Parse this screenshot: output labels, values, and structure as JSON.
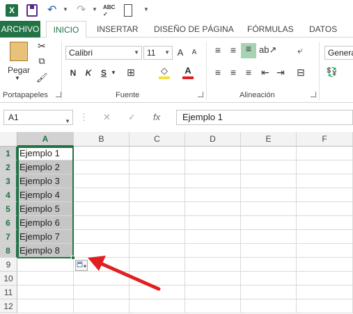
{
  "qat": {
    "excel_letter": "X",
    "spell_label": "ABC"
  },
  "tabs": [
    "ARCHIVO",
    "INICIO",
    "INSERTAR",
    "DISEÑO DE PÁGINA",
    "FÓRMULAS",
    "DATOS"
  ],
  "ribbon": {
    "paste_label": "Pegar",
    "font_name": "Calibri",
    "font_size": "11",
    "bold": "N",
    "italic": "K",
    "underline": "S",
    "number_format": "Genera",
    "groups": {
      "clipboard": "Portapapeles",
      "font": "Fuente",
      "alignment": "Alineación"
    }
  },
  "formula_bar": {
    "name_box": "A1",
    "fx": "fx",
    "value": "Ejemplo 1"
  },
  "sheet": {
    "columns": [
      "A",
      "B",
      "C",
      "D",
      "E",
      "F"
    ],
    "rows": [
      "1",
      "2",
      "3",
      "4",
      "5",
      "6",
      "7",
      "8",
      "9",
      "10",
      "11",
      "12"
    ],
    "column_a": [
      "Ejemplo 1",
      "Ejemplo 2",
      "Ejemplo 3",
      "Ejemplo 4",
      "Ejemplo 5",
      "Ejemplo 6",
      "Ejemplo 7",
      "Ejemplo 8"
    ]
  },
  "colors": {
    "accent": "#217346",
    "arrow": "#e02020",
    "highlight": "#c6c6c6"
  }
}
